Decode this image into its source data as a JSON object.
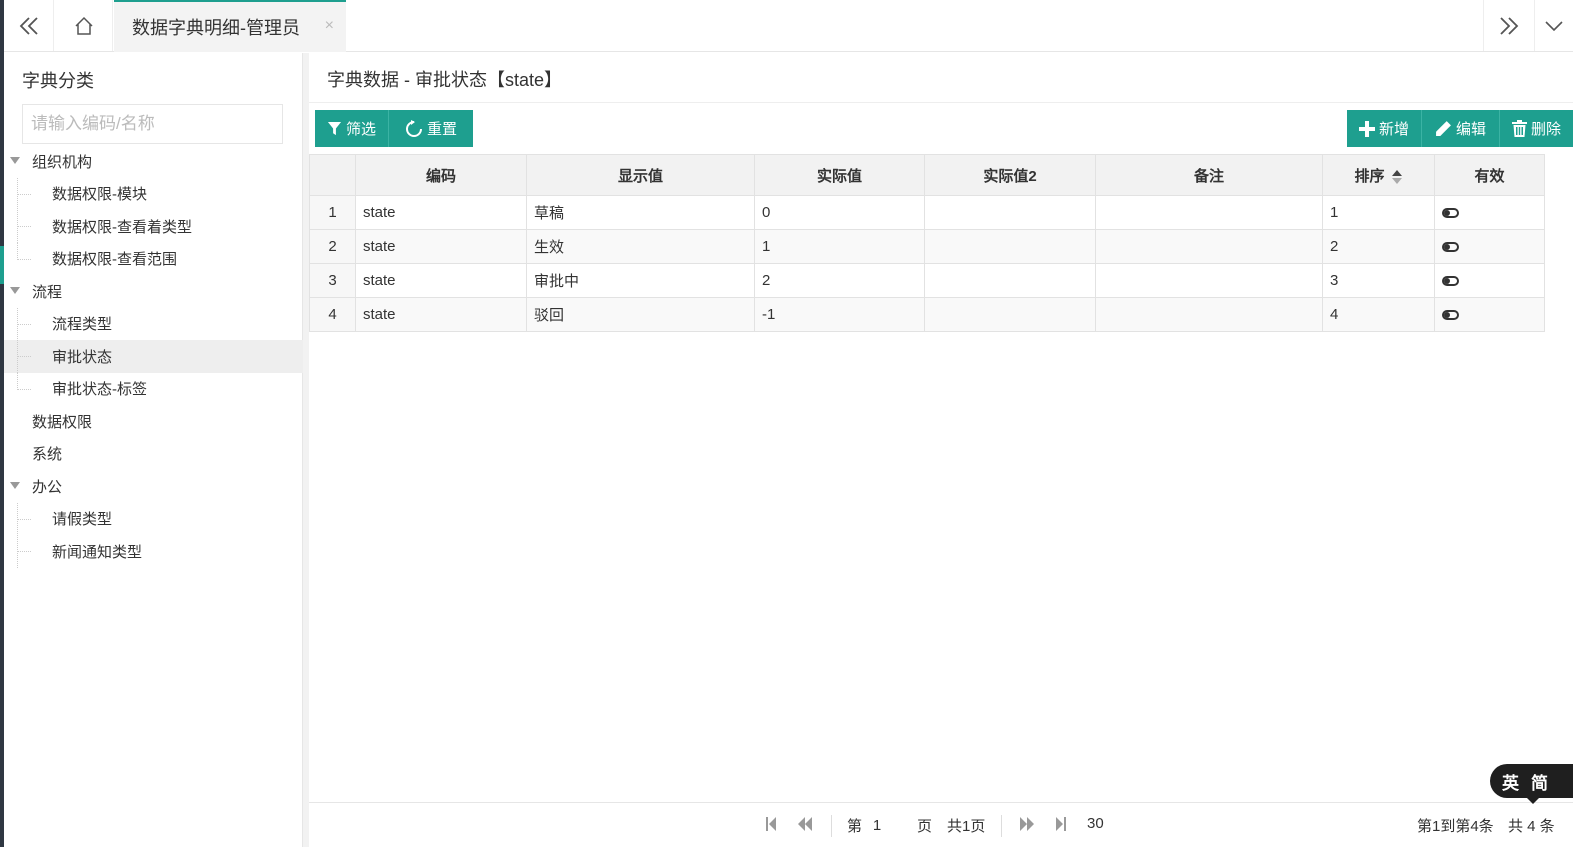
{
  "tabs": {
    "active_label": "数据字典明细-管理员",
    "close_glyph": "×"
  },
  "sidebar": {
    "title": "字典分类",
    "search_placeholder": "请输入编码/名称",
    "tree": [
      {
        "label": "组织机构",
        "level": 1,
        "expanded": true
      },
      {
        "label": "数据权限-模块",
        "level": 2
      },
      {
        "label": "数据权限-查看着类型",
        "level": 2
      },
      {
        "label": "数据权限-查看范围",
        "level": 2
      },
      {
        "label": "流程",
        "level": 1,
        "expanded": true
      },
      {
        "label": "流程类型",
        "level": 2
      },
      {
        "label": "审批状态",
        "level": 2,
        "selected": true
      },
      {
        "label": "审批状态-标签",
        "level": 2
      },
      {
        "label": "数据权限",
        "level": 1
      },
      {
        "label": "系统",
        "level": 1
      },
      {
        "label": "办公",
        "level": 1,
        "expanded": true
      },
      {
        "label": "请假类型",
        "level": 2
      },
      {
        "label": "新闻通知类型",
        "level": 2
      }
    ]
  },
  "main": {
    "title": "字典数据 - 审批状态【state】",
    "toolbar": {
      "filter_label": "筛选",
      "reset_label": "重置",
      "add_label": "新增",
      "edit_label": "编辑",
      "delete_label": "删除"
    },
    "table": {
      "columns": [
        "",
        "编码",
        "显示值",
        "实际值",
        "实际值2",
        "备注",
        "排序",
        "有效"
      ],
      "rows": [
        {
          "idx": "1",
          "code": "state",
          "display": "草稿",
          "value": "0",
          "value2": "",
          "remark": "",
          "order": "1",
          "valid": true
        },
        {
          "idx": "2",
          "code": "state",
          "display": "生效",
          "value": "1",
          "value2": "",
          "remark": "",
          "order": "2",
          "valid": true
        },
        {
          "idx": "3",
          "code": "state",
          "display": "审批中",
          "value": "2",
          "value2": "",
          "remark": "",
          "order": "3",
          "valid": true
        },
        {
          "idx": "4",
          "code": "state",
          "display": "驳回",
          "value": "-1",
          "value2": "",
          "remark": "",
          "order": "4",
          "valid": true
        }
      ]
    },
    "pager": {
      "page_prefix": "第",
      "page_value": "1",
      "page_suffix": "页",
      "total_pages": "共1页",
      "page_size": "30",
      "range_text": "第1到第4条",
      "total_text": "共 4 条"
    }
  },
  "ime": {
    "lang": "英",
    "mode": "简"
  },
  "colors": {
    "accent": "#1e9f8f",
    "sidebar_edge": "#2f3742"
  }
}
